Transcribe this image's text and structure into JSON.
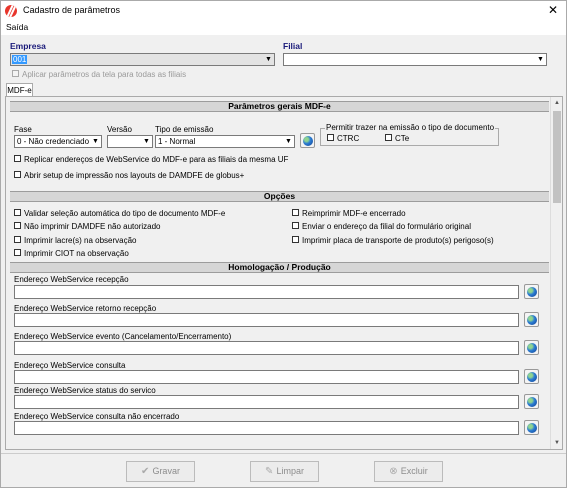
{
  "window": {
    "title": "Cadastro de parâmetros",
    "close_glyph": "✕"
  },
  "menu": {
    "items": [
      "Saída"
    ]
  },
  "header": {
    "empresa_label": "Empresa",
    "empresa_value": "001",
    "filial_label": "Filial",
    "filial_value": "",
    "apply_all_label": "Aplicar parâmetros da tela para todas as filiais"
  },
  "tabs": [
    "MDF-e"
  ],
  "mdfe": {
    "section_title": "Parâmetros gerais MDF-e",
    "fase_label": "Fase",
    "fase_value": "0 - Não credenciado",
    "versao_label": "Versão",
    "versao_value": "",
    "tipo_emissao_label": "Tipo de emissão",
    "tipo_emissao_value": "1 - Normal",
    "permitir_group_label": "Permitir trazer na emissão o tipo de documento",
    "ctrc_label": "CTRC",
    "cte_label": "CTe",
    "replicar_label": "Replicar endereços de WebService do MDF-e para as filiais da mesma UF",
    "abrir_setup_label": "Abrir setup de impressão nos layouts de DAMDFE de globus+"
  },
  "opcoes": {
    "section_title": "Opções",
    "left": [
      "Validar seleção automática do tipo de documento MDF-e",
      "Não imprimir DAMDFE não autorizado",
      "Imprimir lacre(s) na observação",
      "Imprimir CIOT na observação"
    ],
    "right": [
      "Reimprimir MDF-e encerrado",
      "Enviar o endereço da filial do formulário original",
      "Imprimir placa de transporte de produto(s) perigoso(s)"
    ]
  },
  "homologacao": {
    "section_title": "Homologação / Produção",
    "fields": [
      {
        "label": "Endereço WebService recepção",
        "value": ""
      },
      {
        "label": "Endereço WebService retorno recepção",
        "value": ""
      },
      {
        "label": "Endereço WebService evento (Cancelamento/Encerramento)",
        "value": ""
      },
      {
        "label": "Endereço WebService consulta",
        "value": ""
      },
      {
        "label": "Endereço WebService status do servico",
        "value": ""
      },
      {
        "label": "Endereço WebService consulta não encerrado",
        "value": ""
      }
    ]
  },
  "footer": {
    "gravar_label": "Gravar",
    "limpar_label": "Limpar",
    "excluir_label": "Excluir"
  },
  "icons": {
    "combo_arrow": "▼",
    "scroll_up": "▲",
    "scroll_down": "▼",
    "gravar": "✔",
    "limpar": "✎",
    "excluir": "⊗"
  }
}
